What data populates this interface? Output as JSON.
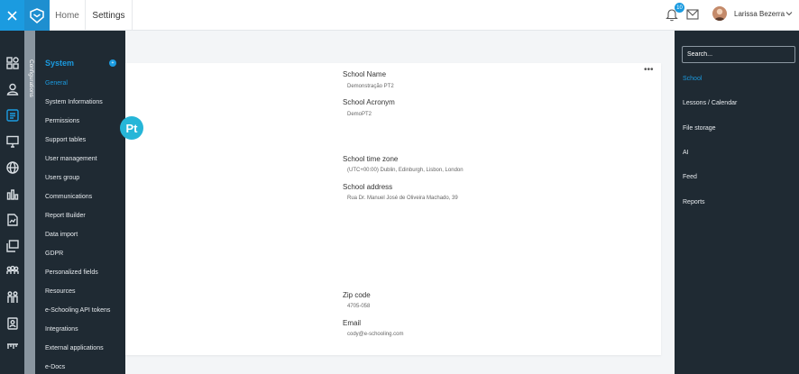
{
  "topbar": {
    "home_label": "Home",
    "settings_label": "Settings",
    "notification_count": "10",
    "user_name": "Larissa Bezerra"
  },
  "rail": {
    "icons": [
      "dashboard-icon",
      "user-icon",
      "list-icon",
      "monitor-icon",
      "globe-icon",
      "bar-chart-icon",
      "document-chart-icon",
      "gallery-icon",
      "group-icon",
      "family-icon",
      "id-card-icon",
      "ruler-icon"
    ]
  },
  "config": {
    "strip_label": "Configurations",
    "section_title": "System",
    "section_badge": "+",
    "items": [
      "General",
      "System Informations",
      "Permissions",
      "Support tables",
      "User management",
      "Users group",
      "Communications",
      "Report Builder",
      "Data import",
      "GDPR",
      "Personalized fields",
      "Resources",
      "e-Schooling API tokens",
      "Integrations",
      "External applications",
      "e-Docs"
    ]
  },
  "school": {
    "logo_text": "Pt",
    "more_label": "•••",
    "fields": [
      {
        "label": "School Name",
        "value": "Demonstração PT2"
      },
      {
        "label": "School Acronym",
        "value": "DemoPT2"
      },
      {
        "label": "School time zone",
        "value": "(UTC+00:00) Dublin, Edinburgh, Lisbon, London"
      },
      {
        "label": "School address",
        "value": "Rua Dr. Manuel José de Oliveira Machado, 39"
      },
      {
        "label": "Zip code",
        "value": "4705-058"
      },
      {
        "label": "Email",
        "value": "cody@e-schooling.com"
      }
    ]
  },
  "right_panel": {
    "search_placeholder": "Search...",
    "items": [
      "School",
      "Lessons / Calendar",
      "File storage",
      "AI",
      "Feed",
      "Reports"
    ]
  },
  "colors": {
    "accent": "#1b9be0",
    "sidebar_bg": "#1f2a33",
    "strip_bg": "#8a96a0",
    "logo_bg": "#26b6d8"
  }
}
